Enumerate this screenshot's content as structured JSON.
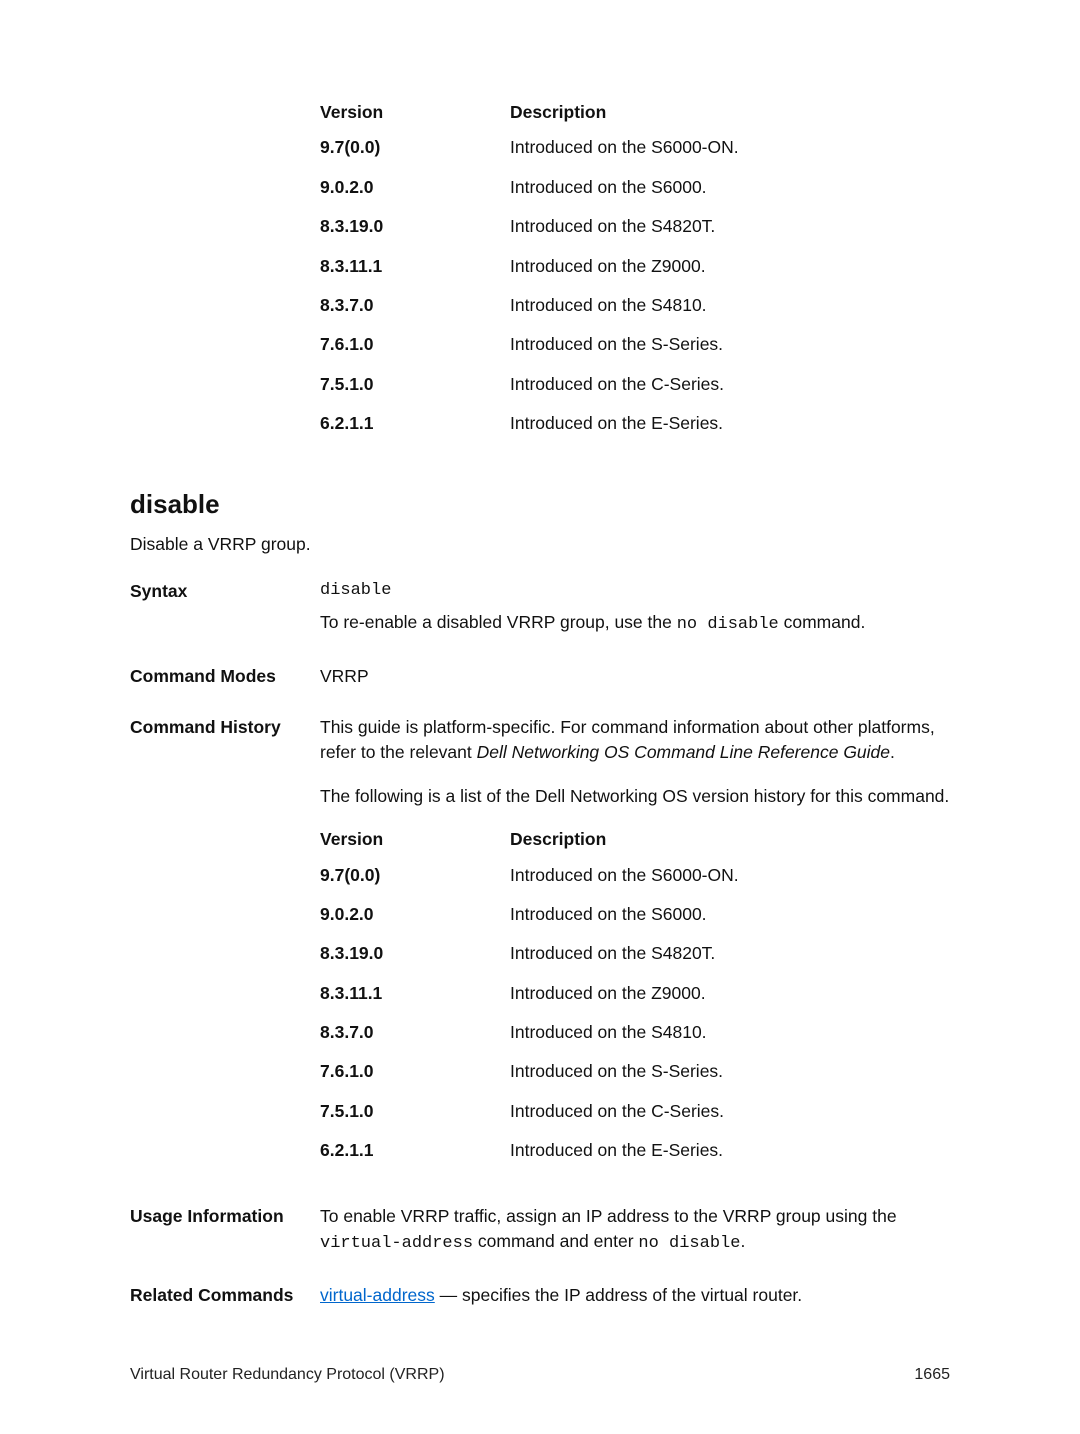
{
  "top_table": {
    "headers": {
      "version": "Version",
      "description": "Description"
    },
    "rows": [
      {
        "version": "9.7(0.0)",
        "description": "Introduced on the S6000-ON."
      },
      {
        "version": "9.0.2.0",
        "description": "Introduced on the S6000."
      },
      {
        "version": "8.3.19.0",
        "description": "Introduced on the S4820T."
      },
      {
        "version": "8.3.11.1",
        "description": "Introduced on the Z9000."
      },
      {
        "version": "8.3.7.0",
        "description": "Introduced on the S4810."
      },
      {
        "version": "7.6.1.0",
        "description": "Introduced on the S-Series."
      },
      {
        "version": "7.5.1.0",
        "description": "Introduced on the C-Series."
      },
      {
        "version": "6.2.1.1",
        "description": "Introduced on the E-Series."
      }
    ]
  },
  "section": {
    "title": "disable",
    "subtitle": "Disable a VRRP group."
  },
  "defs": {
    "syntax_label": "Syntax",
    "syntax_cmd": "disable",
    "syntax_text_pre": "To re-enable a disabled VRRP group, use the ",
    "syntax_text_cmd": "no disable",
    "syntax_text_post": " command.",
    "cmd_modes_label": "Command Modes",
    "cmd_modes_value": "VRRP",
    "cmd_history_label": "Command History",
    "cmd_history_para1_pre": "This guide is platform-specific. For command information about other platforms, refer to the relevant ",
    "cmd_history_para1_italic": "Dell Networking OS Command Line Reference Guide",
    "cmd_history_para1_post": ".",
    "cmd_history_para2": "The following is a list of the Dell Networking OS version history for this command.",
    "history_table": {
      "headers": {
        "version": "Version",
        "description": "Description"
      },
      "rows": [
        {
          "version": "9.7(0.0)",
          "description": "Introduced on the S6000-ON."
        },
        {
          "version": "9.0.2.0",
          "description": "Introduced on the S6000."
        },
        {
          "version": "8.3.19.0",
          "description": "Introduced on the S4820T."
        },
        {
          "version": "8.3.11.1",
          "description": "Introduced on the Z9000."
        },
        {
          "version": "8.3.7.0",
          "description": "Introduced on the S4810."
        },
        {
          "version": "7.6.1.0",
          "description": "Introduced on the S-Series."
        },
        {
          "version": "7.5.1.0",
          "description": "Introduced on the C-Series."
        },
        {
          "version": "6.2.1.1",
          "description": "Introduced on the E-Series."
        }
      ]
    },
    "usage_label": "Usage Information",
    "usage_text_pre": "To enable VRRP traffic, assign an IP address to the VRRP group using the ",
    "usage_cmd1": "virtual-address",
    "usage_text_mid": " command and enter ",
    "usage_cmd2": "no disable",
    "usage_text_post": ".",
    "related_label": "Related Commands",
    "related_link": "virtual-address",
    "related_text": " — specifies the IP address of the virtual router."
  },
  "footer": {
    "left": "Virtual Router Redundancy Protocol (VRRP)",
    "right": "1665"
  }
}
